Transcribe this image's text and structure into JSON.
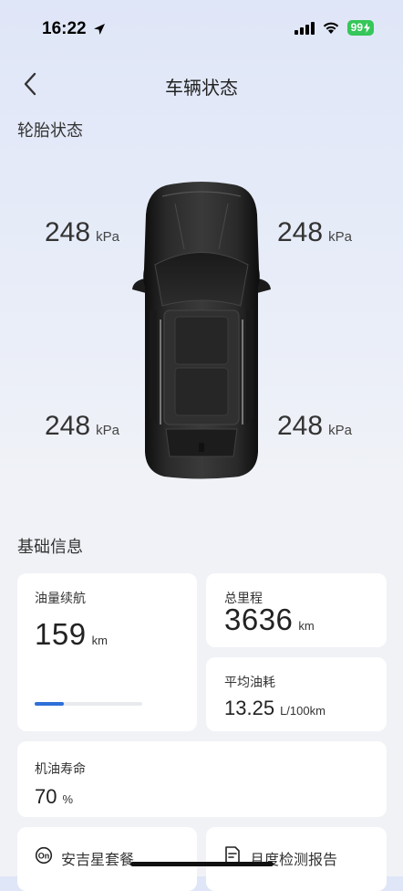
{
  "status_bar": {
    "time": "16:22",
    "battery": "99"
  },
  "header": {
    "title": "车辆状态"
  },
  "tires": {
    "section_title": "轮胎状态",
    "unit": "kPa",
    "front_left": "248",
    "front_right": "248",
    "rear_left": "248",
    "rear_right": "248"
  },
  "basic_info": {
    "section_title": "基础信息",
    "fuel_range": {
      "label": "油量续航",
      "value": "159",
      "unit": "km",
      "progress_fraction": 0.27
    },
    "total_mileage": {
      "label": "总里程",
      "value": "3636",
      "unit": "km"
    },
    "avg_fuel": {
      "label": "平均油耗",
      "value": "13.25",
      "unit": "L/100km"
    },
    "oil_life": {
      "label": "机油寿命",
      "value": "70",
      "unit": "%"
    }
  },
  "bottom_links": {
    "package": "安吉星套餐",
    "report": "月度检测报告"
  },
  "colors": {
    "accent": "#2f6fd9",
    "battery": "#35c759"
  }
}
